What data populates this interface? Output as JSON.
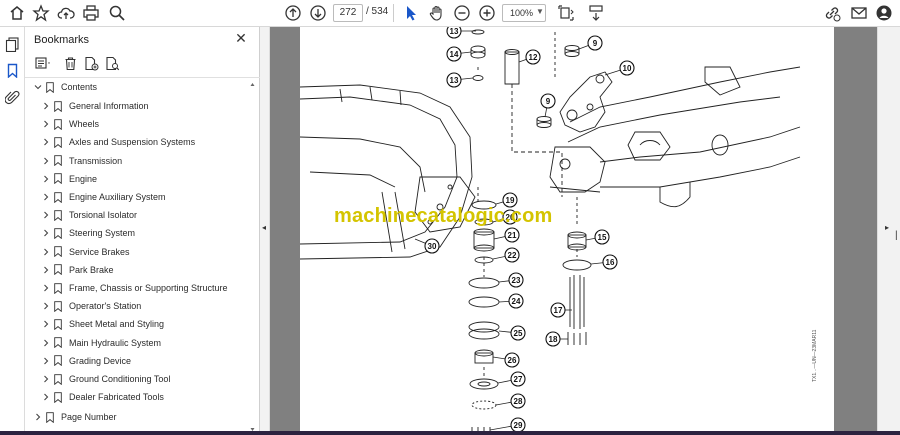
{
  "toolbar": {
    "page_current": "272",
    "page_total": "/ 534",
    "zoom": "100%"
  },
  "bookmarks": {
    "title": "Bookmarks",
    "contents_label": "Contents",
    "items": [
      "General Information",
      "Wheels",
      "Axles and Suspension Systems",
      "Transmission",
      "Engine",
      "Engine Auxiliary System",
      "Torsional Isolator",
      "Steering System",
      "Service Brakes",
      "Park Brake",
      "Frame, Chassis or Supporting Structure",
      "Operator's Station",
      "Sheet Metal and Styling",
      "Main Hydraulic System",
      "Grading Device",
      "Ground Conditioning Tool",
      "Dealer Fabricated Tools"
    ],
    "page_number_label": "Page Number"
  },
  "document": {
    "watermark": "machinecatalogic.com",
    "side_code": "TX1...—UN—23MAR11",
    "callouts": [
      "13",
      "14",
      "13",
      "12",
      "9",
      "10",
      "9",
      "19",
      "20",
      "21",
      "22",
      "23",
      "24",
      "25",
      "26",
      "27",
      "28",
      "29",
      "30",
      "15",
      "16",
      "17",
      "18"
    ]
  },
  "colors": {
    "watermark": "#d4c400",
    "viewer_bg": "#808080"
  }
}
